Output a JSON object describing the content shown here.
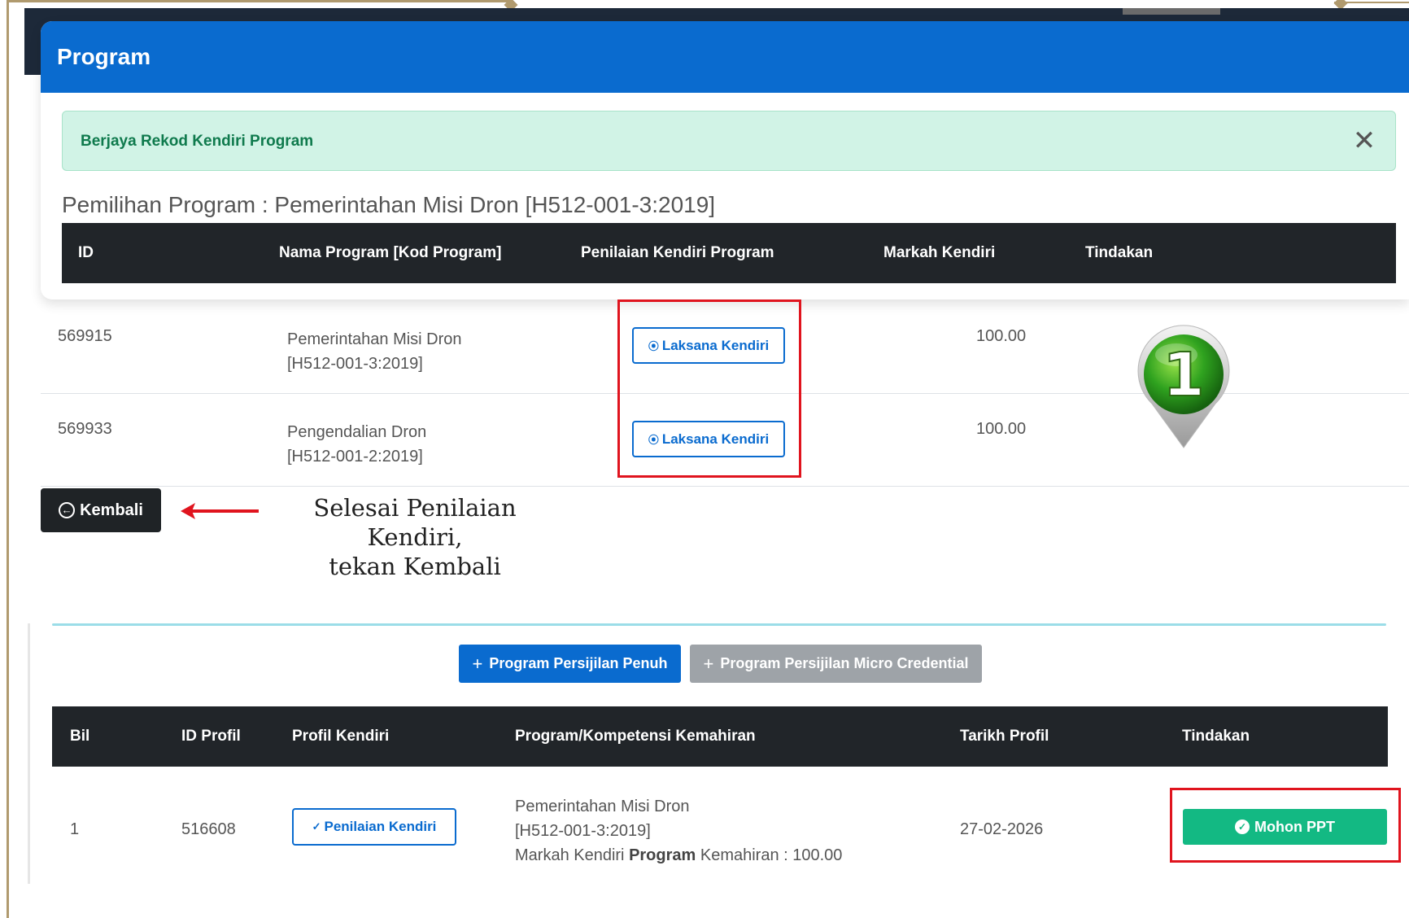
{
  "modal": {
    "title": "Program",
    "alert_text": "Berjaya Rekod Kendiri Program",
    "close_glyph": "✕"
  },
  "selection_title": "Pemilihan Program : Pemerintahan Misi Dron [H512-001-3:2019]",
  "program_table": {
    "headers": [
      "ID",
      "Nama Program [Kod Program]",
      "Penilaian Kendiri Program",
      "Markah Kendiri",
      "Tindakan"
    ],
    "rows": [
      {
        "id": "569915",
        "name": "Pemerintahan Misi Dron",
        "code": "[H512-001-3:2019]",
        "action_label": "Laksana Kendiri",
        "score": "100.00"
      },
      {
        "id": "569933",
        "name": "Pengendalian Dron",
        "code": "[H512-001-2:2019]",
        "action_label": "Laksana Kendiri",
        "score": "100.00"
      }
    ]
  },
  "back_button": "Kembali",
  "annotation": {
    "line1": "Selesai Penilaian Kendiri,",
    "line2": "tekan Kembali",
    "marker_number": "1"
  },
  "add_buttons": {
    "full": "Program Persijilan Penuh",
    "micro": "Program Persijilan Micro Credential"
  },
  "profile_table": {
    "headers": [
      "Bil",
      "ID Profil",
      "Profil Kendiri",
      "Program/Kompetensi Kemahiran",
      "Tarikh Profil",
      "Tindakan"
    ],
    "rows": [
      {
        "bil": "1",
        "profile_id": "516608",
        "profile_action": "Penilaian Kendiri",
        "program_name": "Pemerintahan Misi Dron",
        "program_code": "[H512-001-3:2019]",
        "score_prefix": "Markah Kendiri ",
        "score_bold": "Program",
        "score_suffix": " Kemahiran : 100.00",
        "date": "27-02-2026",
        "action_label": "Mohon PPT"
      }
    ]
  },
  "colors": {
    "primary": "#0a6bcf",
    "success": "#13b983",
    "dark": "#212529",
    "highlight": "#e0141e"
  },
  "icons": [
    "close-icon",
    "radio-dot-icon",
    "arrow-left-circle-icon",
    "plus-icon",
    "check-circle-icon",
    "map-pin-icon",
    "red-arrow-icon"
  ]
}
